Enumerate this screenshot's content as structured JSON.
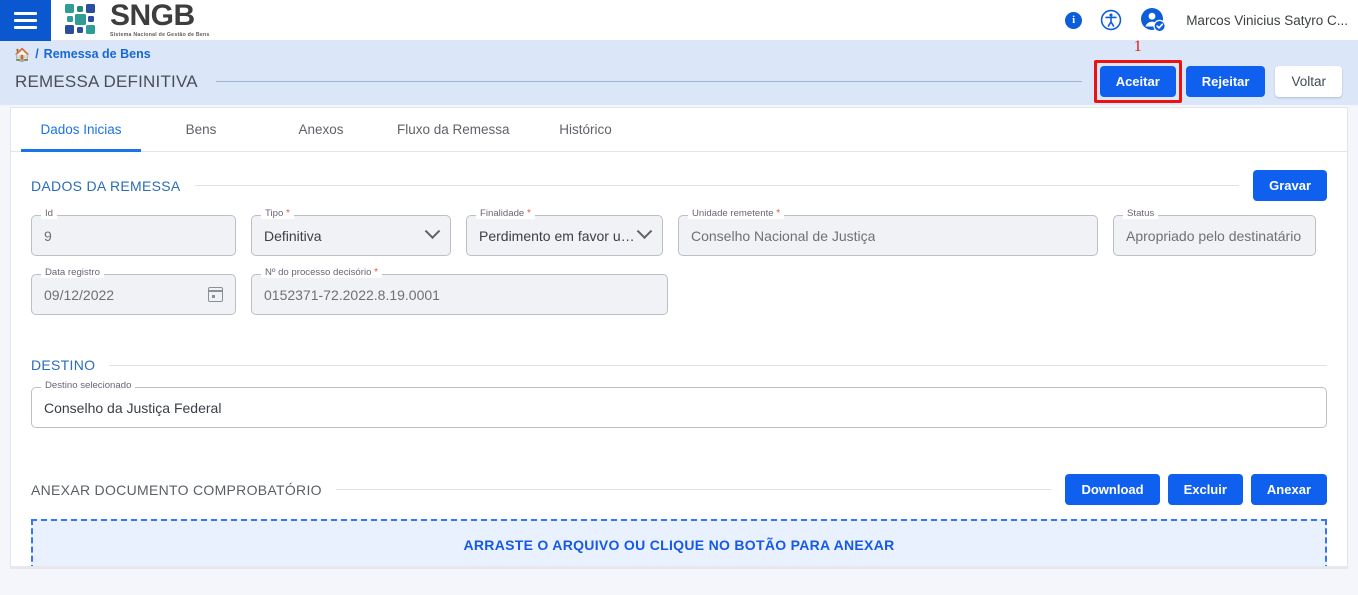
{
  "topbar": {
    "menu_icon": "hamburger-menu-icon",
    "brand_name": "SNGB",
    "brand_tagline": "Sistema Nacional de Gestão de Bens",
    "info_icon": "i",
    "accessibility_icon": "accessibility-icon",
    "avatar_icon": "user-avatar-icon",
    "user_name": "Marcos Vinicius Satyro C...",
    "accent_color": "#0a57d0"
  },
  "breadcrumb": {
    "home_icon": "⌂",
    "separator": "/",
    "link": "Remessa de Bens"
  },
  "page": {
    "title": "REMESSA DEFINITIVA",
    "actions": [
      {
        "label": "Aceitar",
        "style": "primary",
        "annotated": true,
        "annotation": "1"
      },
      {
        "label": "Rejeitar",
        "style": "primary",
        "annotated": false
      },
      {
        "label": "Voltar",
        "style": "light",
        "annotated": false
      }
    ]
  },
  "tabs": [
    {
      "label": "Dados Inicias",
      "active": true
    },
    {
      "label": "Bens",
      "active": false
    },
    {
      "label": "Anexos",
      "active": false
    },
    {
      "label": "Fluxo da Remessa",
      "active": false
    },
    {
      "label": "Histórico",
      "active": false
    }
  ],
  "sections": {
    "remessa": {
      "title": "DADOS DA REMESSA",
      "save_button": "Gravar",
      "fields": [
        {
          "label": "Id",
          "required": false,
          "value": "9",
          "control": "text"
        },
        {
          "label": "Tipo",
          "required": true,
          "value": "Definitiva",
          "control": "select"
        },
        {
          "label": "Finalidade",
          "required": true,
          "value": "Perdimento em favor união",
          "control": "select"
        },
        {
          "label": "Unidade remetente",
          "required": true,
          "value": "Conselho Nacional de Justiça",
          "control": "text"
        },
        {
          "label": "Status",
          "required": false,
          "value": "Apropriado pelo destinatário",
          "control": "text"
        },
        {
          "label": "Data registro",
          "required": false,
          "value": "09/12/2022",
          "control": "date"
        },
        {
          "label": "Nº do processo decisório",
          "required": true,
          "value": "0152371-72.2022.8.19.0001",
          "control": "text"
        }
      ]
    },
    "destino": {
      "title": "DESTINO",
      "field": {
        "label": "Destino selecionado",
        "required": false,
        "value": "Conselho da Justiça Federal"
      }
    },
    "anexo": {
      "title": "ANEXAR DOCUMENTO COMPROBATÓRIO",
      "buttons": [
        {
          "label": "Download"
        },
        {
          "label": "Excluir"
        },
        {
          "label": "Anexar"
        }
      ],
      "dropzone_text": "ARRASTE O ARQUIVO OU CLIQUE NO BOTÃO PARA ANEXAR"
    }
  }
}
